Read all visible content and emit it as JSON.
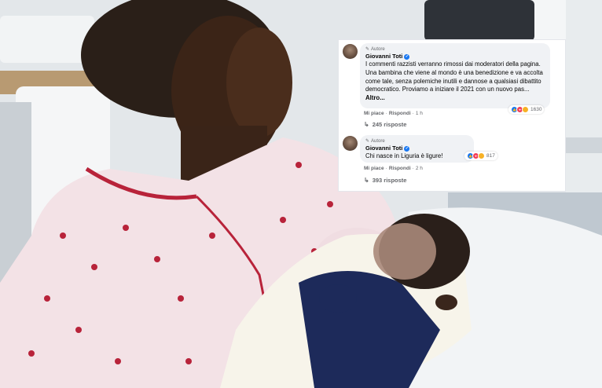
{
  "comments": [
    {
      "badge": "Autore",
      "author": "Giovanni Toti",
      "text": "I commenti razzisti verranno rimossi dai moderatori della pagina. Una bambina che viene al mondo è una benedizione e va accolta come tale, senza polemiche inutili e dannose a qualsiasi dibattito democratico. Proviamo a iniziare il 2021 con un nuovo pas...",
      "more": "Altro...",
      "reaction_count": "1630",
      "like": "Mi piace",
      "reply": "Rispondi",
      "time": "1 h",
      "replies": "245 risposte"
    },
    {
      "badge": "Autore",
      "author": "Giovanni Toti",
      "text": "Chi nasce in Liguria è ligure!",
      "more": "",
      "reaction_count": "817",
      "like": "Mi piace",
      "reply": "Rispondi",
      "time": "2 h",
      "replies": "393 risposte"
    }
  ],
  "icons": {
    "author": "pencil-icon",
    "verified": "verified-badge-icon",
    "reactions": [
      "like-reaction-icon",
      "love-reaction-icon",
      "haha-reaction-icon"
    ],
    "reply": "reply-arrow-icon"
  },
  "colors": {
    "accent": "#1877f2",
    "bubble": "#f0f2f5",
    "meta": "#65676b",
    "text": "#050505"
  }
}
